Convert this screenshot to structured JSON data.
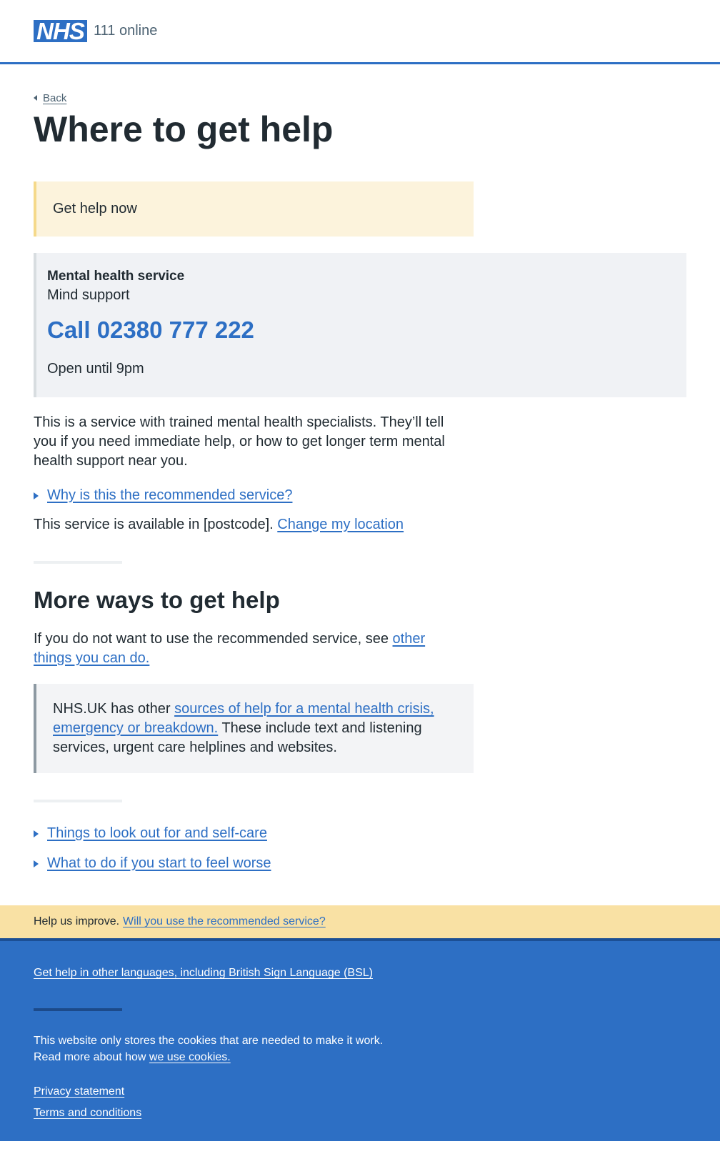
{
  "header": {
    "logo_text": "NHS",
    "service_name": "111 online"
  },
  "nav": {
    "back_label": "Back"
  },
  "page": {
    "title": "Where to get help"
  },
  "warning": {
    "text": "Get help now"
  },
  "service_card": {
    "type": "Mental health service",
    "name": "Mind support",
    "call_label": "Call 02380 777 222",
    "opening": "Open until 9pm"
  },
  "description": "This is a service with trained mental health specialists. They’ll tell you if you need immediate help, or how to get longer term mental health support near you.",
  "why_recommended": "Why is this the recommended service?",
  "availability": {
    "text": "This service is available in [postcode].",
    "change_link": "Change my location"
  },
  "more_ways": {
    "heading": "More ways to get help",
    "text": "If you do not want to use the recommended service, see",
    "link": "other things you can do."
  },
  "inset": {
    "text_before": "NHS.UK has other",
    "link": "sources of help for a mental health crisis, emergency or breakdown.",
    "text_after": "These include text and listening services, urgent care helplines and websites."
  },
  "details": {
    "lookout": "Things to look out for and self-care",
    "worse": "What to do if you start to feel worse"
  },
  "feedback": {
    "text": "Help us improve.",
    "link": "Will you use the recommended service?"
  },
  "footer": {
    "languages_link": "Get help in other languages, including British Sign Language (BSL)",
    "cookies_line1": "This website only stores the cookies that are needed to make it work.",
    "cookies_line2": "Read more about how",
    "cookies_link": "we use cookies.",
    "privacy_link": "Privacy statement",
    "terms_link": "Terms and conditions"
  },
  "colors": {
    "brand_blue": "#2d6fc4",
    "warning_bg": "#fcf3dc",
    "feedback_bg": "#f9e1a4",
    "card_bg": "#f0f2f5",
    "text": "#212b32"
  }
}
